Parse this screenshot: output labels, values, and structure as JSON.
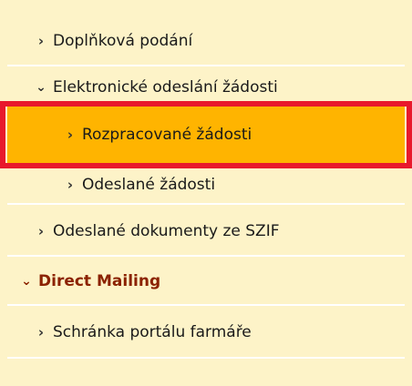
{
  "menu": {
    "items": [
      {
        "label": "Doplňková podání",
        "chevron": "chevron-right-icon"
      },
      {
        "label": "Elektronické odeslání žádosti",
        "chevron": "chevron-down-icon"
      },
      {
        "label": "Rozpracované žádosti",
        "chevron": "chevron-right-icon",
        "active": true
      },
      {
        "label": "Odeslané žádosti",
        "chevron": "chevron-right-icon"
      },
      {
        "label": "Odeslané dokumenty ze SZIF",
        "chevron": "chevron-right-icon"
      },
      {
        "label": "Direct Mailing",
        "chevron": "chevron-down-icon"
      },
      {
        "label": "Schránka portálu farmáře",
        "chevron": "chevron-right-icon"
      }
    ]
  },
  "colors": {
    "menu_background": "#fdf3c8",
    "active_background": "#ffb400",
    "highlight_border": "#e8192c",
    "section_heading_text": "#8b2200"
  }
}
